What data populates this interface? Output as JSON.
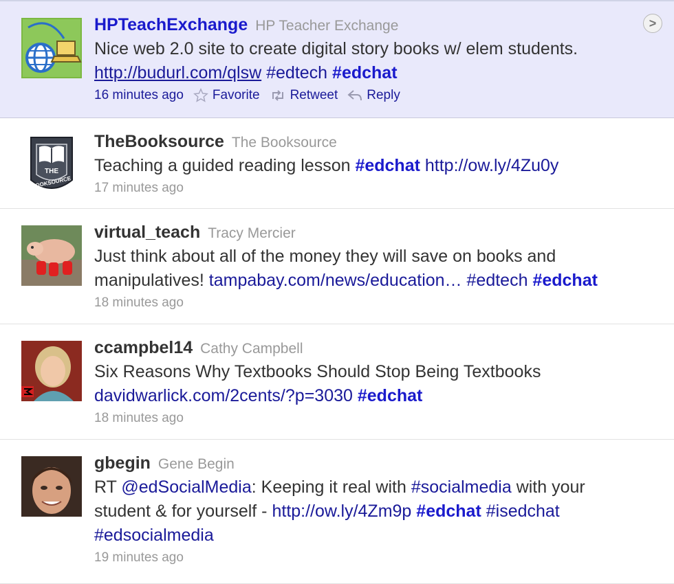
{
  "timeline": {
    "tweets": [
      {
        "screen_name": "HPTeachExchange",
        "full_name": "HP Teacher Exchange",
        "time": "16 minutes ago",
        "text": {
          "t1": "Nice web 2.0 site to create digital story books w/ elem students.",
          "link1": "http://budurl.com/qlsw",
          "hash1": "#edtech",
          "hash2": "#edchat"
        },
        "actions": {
          "favorite": "Favorite",
          "retweet": "Retweet",
          "reply": "Reply"
        },
        "expand_icon": ">"
      },
      {
        "screen_name": "TheBooksource",
        "full_name": "The Booksource",
        "time": "17 minutes ago",
        "text": {
          "t1": "Teaching a guided reading lesson",
          "hash1": "#edchat",
          "link1": "http://ow.ly/4Zu0y"
        },
        "avatar_text": {
          "line1": "THE",
          "line2": "BOOKSOURCE"
        }
      },
      {
        "screen_name": "virtual_teach",
        "full_name": "Tracy Mercier",
        "time": "18 minutes ago",
        "text": {
          "t1": "Just think about all of the money they will save on books and manipulatives!",
          "link1": "tampabay.com/news/education…",
          "hash1": "#edtech",
          "hash2": "#edchat"
        }
      },
      {
        "screen_name": "ccampbel14",
        "full_name": "Cathy Campbell",
        "time": "18 minutes ago",
        "text": {
          "t1": "Six Reasons Why Textbooks Should Stop Being Textbooks",
          "link1": "davidwarlick.com/2cents/?p=3030",
          "hash1": "#edchat"
        }
      },
      {
        "screen_name": "gbegin",
        "full_name": "Gene Begin",
        "time": "19 minutes ago",
        "text": {
          "t1": "RT",
          "mention1": "@edSocialMedia",
          "t2": ": Keeping it real with",
          "hash1": "#socialmedia",
          "t3": "with your student & for yourself -",
          "link1": "http://ow.ly/4Zm9p",
          "hash2": "#edchat",
          "hash3": "#isedchat",
          "hash4": "#edsocialmedia"
        }
      }
    ]
  },
  "colors": {
    "link": "#1a1a99",
    "hashtag_bold": "#1a1acc",
    "selected_bg": "#e9e9fb",
    "meta": "#999999"
  }
}
